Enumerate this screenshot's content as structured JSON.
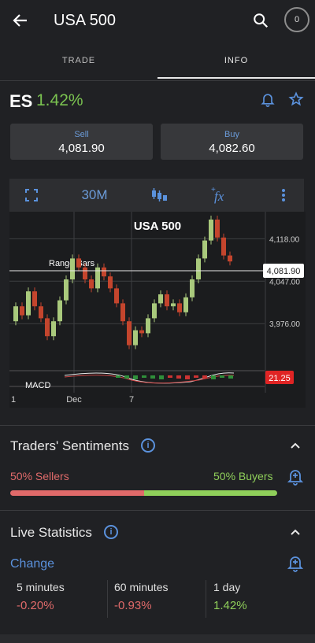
{
  "header": {
    "title": "USA 500",
    "notification_count": "0",
    "icons": [
      "back-arrow-icon",
      "search-icon"
    ]
  },
  "tabs": [
    {
      "label": "TRADE",
      "active": false
    },
    {
      "label": "INFO",
      "active": true
    }
  ],
  "instrument": {
    "symbol": "ES",
    "change": "1.42%",
    "change_color": "#7ac250"
  },
  "prices": {
    "sell_label": "Sell",
    "sell_value": "4,081.90",
    "buy_label": "Buy",
    "buy_value": "4,082.60"
  },
  "chart_toolbar": {
    "timeframe": "30M",
    "icons": [
      "fullscreen-icon",
      "candles-type-icon",
      "indicator-fx-icon",
      "more-vert-icon"
    ]
  },
  "chart_data": {
    "type": "candlestick",
    "title": "USA 500",
    "overlay_label": "Range Bars",
    "indicator_label": "MACD",
    "indicator_value": "21.25",
    "current_price": "4,081.90",
    "y_ticks": [
      "4,118.00",
      "4,047.00",
      "3,976.00"
    ],
    "x_ticks": [
      "1",
      "Dec",
      "7"
    ],
    "ylim": [
      3900,
      4150
    ],
    "candles": [
      {
        "o": 3980,
        "c": 4005,
        "bull": true
      },
      {
        "o": 4005,
        "c": 3990,
        "bull": false
      },
      {
        "o": 3990,
        "c": 4030,
        "bull": true
      },
      {
        "o": 4030,
        "c": 4005,
        "bull": false
      },
      {
        "o": 4005,
        "c": 3985,
        "bull": false
      },
      {
        "o": 3985,
        "c": 3955,
        "bull": false
      },
      {
        "o": 3955,
        "c": 3980,
        "bull": true
      },
      {
        "o": 3980,
        "c": 4015,
        "bull": true
      },
      {
        "o": 4015,
        "c": 4050,
        "bull": true
      },
      {
        "o": 4050,
        "c": 4085,
        "bull": true
      },
      {
        "o": 4085,
        "c": 4070,
        "bull": false
      },
      {
        "o": 4070,
        "c": 4050,
        "bull": false
      },
      {
        "o": 4050,
        "c": 4035,
        "bull": false
      },
      {
        "o": 4035,
        "c": 4070,
        "bull": true
      },
      {
        "o": 4070,
        "c": 4055,
        "bull": false
      },
      {
        "o": 4055,
        "c": 4035,
        "bull": false
      },
      {
        "o": 4035,
        "c": 4010,
        "bull": false
      },
      {
        "o": 4010,
        "c": 3980,
        "bull": false
      },
      {
        "o": 3980,
        "c": 3940,
        "bull": false
      },
      {
        "o": 3940,
        "c": 3965,
        "bull": true
      },
      {
        "o": 3965,
        "c": 3960,
        "bull": false
      },
      {
        "o": 3960,
        "c": 3985,
        "bull": true
      },
      {
        "o": 3985,
        "c": 4010,
        "bull": true
      },
      {
        "o": 4010,
        "c": 4025,
        "bull": true
      },
      {
        "o": 4025,
        "c": 4005,
        "bull": false
      },
      {
        "o": 4005,
        "c": 4010,
        "bull": true
      },
      {
        "o": 4010,
        "c": 3995,
        "bull": false
      },
      {
        "o": 3995,
        "c": 4020,
        "bull": true
      },
      {
        "o": 4020,
        "c": 4050,
        "bull": true
      },
      {
        "o": 4050,
        "c": 4085,
        "bull": true
      },
      {
        "o": 4085,
        "c": 4115,
        "bull": true
      },
      {
        "o": 4115,
        "c": 4150,
        "bull": true
      },
      {
        "o": 4150,
        "c": 4120,
        "bull": false
      },
      {
        "o": 4120,
        "c": 4090,
        "bull": false
      },
      {
        "o": 4090,
        "c": 4080,
        "bull": false
      }
    ],
    "up_color": "#a9c97c",
    "down_color": "#c4452d"
  },
  "sentiment": {
    "title": "Traders' Sentiments",
    "sellers_label": "50% Sellers",
    "buyers_label": "50% Buyers",
    "sellers_pct": 50,
    "sell_color": "#e06a6a",
    "buy_color": "#8fcf5a"
  },
  "live_stats": {
    "title": "Live Statistics",
    "change_label": "Change",
    "items": [
      {
        "period": "5 minutes",
        "value": "-0.20%",
        "color": "#e06a6a"
      },
      {
        "period": "60 minutes",
        "value": "-0.93%",
        "color": "#e06a6a"
      },
      {
        "period": "1 day",
        "value": "1.42%",
        "color": "#8fcf5a"
      }
    ]
  }
}
